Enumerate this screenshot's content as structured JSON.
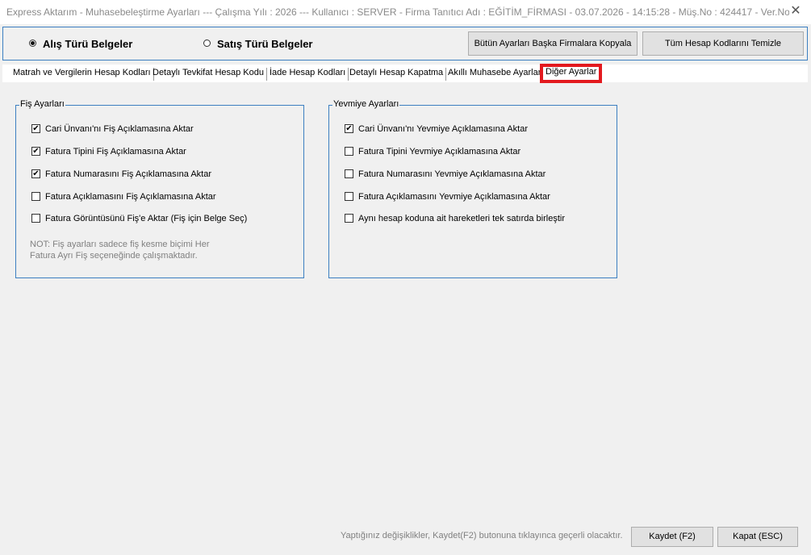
{
  "window": {
    "title": "Express Aktarım - Muhasebeleştirme Ayarları  ---  Çalışma Yılı : 2026  ---  Kullanıcı : SERVER - Firma Tanıtıcı Adı : EĞİTİM_FİRMASI - 03.07.2026 - 14:15:28 - Müş.No : 424417 - Ver.No :...",
    "close_glyph": "✕"
  },
  "doc_type": {
    "alis_label": "Alış Türü Belgeler",
    "satis_label": "Satış Türü Belgeler",
    "selected": "alis"
  },
  "top_buttons": {
    "copy_label": "Bütün Ayarları Başka Firmalara Kopyala",
    "clear_label": "Tüm Hesap Kodlarını Temizle"
  },
  "tabs": [
    {
      "label": "Matrah ve Vergilerin Hesap Kodları"
    },
    {
      "label": "Detaylı Tevkifat Hesap Kodu"
    },
    {
      "label": "İade Hesap Kodları"
    },
    {
      "label": "Detaylı Hesap Kapatma"
    },
    {
      "label": "Akıllı Muhasebe Ayarları"
    },
    {
      "label": "Diğer Ayarlar",
      "active": true
    }
  ],
  "fis_group": {
    "legend": "Fiş Ayarları",
    "options": [
      {
        "label": "Cari Ünvanı'nı Fiş Açıklamasına Aktar",
        "checked": true
      },
      {
        "label": "Fatura Tipini Fiş Açıklamasına Aktar",
        "checked": true
      },
      {
        "label": "Fatura Numarasını Fiş Açıklamasına Aktar",
        "checked": true
      },
      {
        "label": "Fatura Açıklamasını Fiş Açıklamasına Aktar",
        "checked": false
      },
      {
        "label": "Fatura Görüntüsünü Fiş'e Aktar (Fiş için Belge Seç)",
        "checked": false
      }
    ],
    "note_line1": "NOT: Fiş ayarları sadece fiş kesme biçimi Her",
    "note_line2": "Fatura Ayrı Fiş seçeneğinde çalışmaktadır."
  },
  "yevmiye_group": {
    "legend": "Yevmiye Ayarları",
    "options": [
      {
        "label": "Cari Ünvanı'nı Yevmiye Açıklamasına Aktar",
        "checked": true
      },
      {
        "label": "Fatura Tipini Yevmiye Açıklamasına Aktar",
        "checked": false
      },
      {
        "label": "Fatura Numarasını Yevmiye Açıklamasına Aktar",
        "checked": false
      },
      {
        "label": "Fatura Açıklamasını Yevmiye Açıklamasına Aktar",
        "checked": false
      },
      {
        "label": "Aynı hesap koduna ait hareketleri tek satırda birleştir",
        "checked": false
      }
    ]
  },
  "footer": {
    "note": "Yaptığınız değişiklikler, Kaydet(F2) butonuna tıklayınca geçerli olacaktır.",
    "save_label": "Kaydet (F2)",
    "close_label": "Kapat (ESC)"
  },
  "colors": {
    "accent_border": "#3c7fc1",
    "active_tab_highlight": "#e3191e",
    "background": "#f0f0f0"
  }
}
